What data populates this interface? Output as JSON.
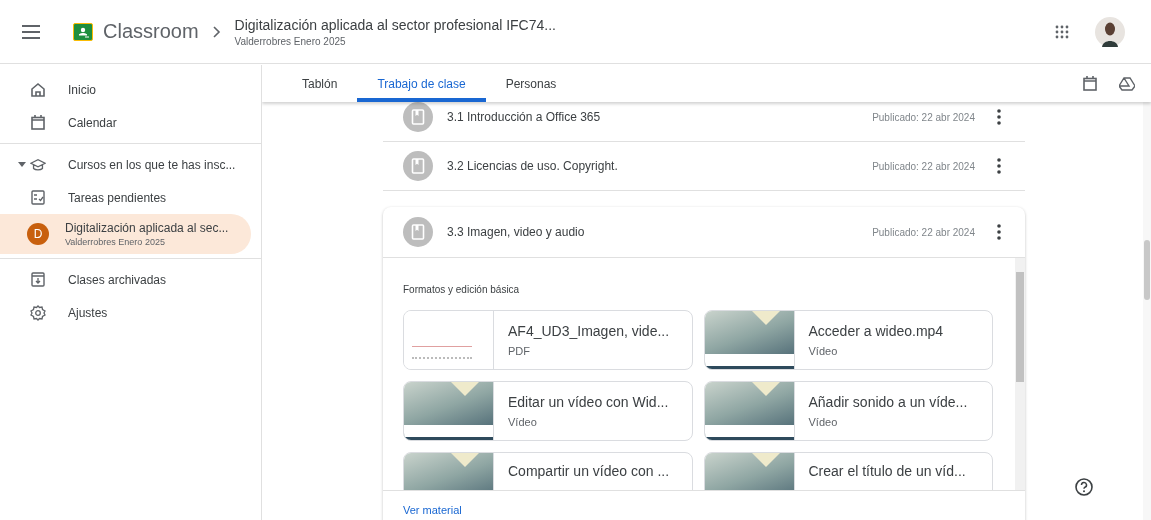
{
  "header": {
    "app_name": "Classroom",
    "course_title": "Digitalización aplicada al sector profesional IFC74...",
    "course_subtitle": "Valderrobres Enero 2025"
  },
  "sidebar": {
    "groups": [
      {
        "items": [
          {
            "kind": "nav",
            "label": "Inicio",
            "selected": false
          },
          {
            "kind": "nav",
            "label": "Calendar",
            "selected": false
          }
        ]
      },
      {
        "items": [
          {
            "kind": "section",
            "label": "Cursos en los que te has insc...",
            "expanded": true,
            "selected": false
          },
          {
            "kind": "nav",
            "label": "Tareas pendientes",
            "selected": false
          },
          {
            "kind": "course",
            "label": "Digitalización aplicada al sec...",
            "subtitle": "Valderrobres Enero 2025",
            "avatar_letter": "D",
            "selected": true
          }
        ]
      },
      {
        "items": [
          {
            "kind": "nav",
            "label": "Clases archivadas",
            "selected": false
          },
          {
            "kind": "nav",
            "label": "Ajustes",
            "selected": false
          }
        ]
      }
    ]
  },
  "tabs": [
    {
      "label": "Tablón",
      "selected": false
    },
    {
      "label": "Trabajo de clase",
      "selected": true
    },
    {
      "label": "Personas",
      "selected": false
    }
  ],
  "topics": [
    {
      "title": "3.1 Introducción a Office 365",
      "published": "Publicado: 22 abr 2024",
      "expanded": false
    },
    {
      "title": "3.2 Licencias de uso. Copyright.",
      "published": "Publicado: 22 abr 2024",
      "expanded": false
    },
    {
      "title": "3.3 Imagen, video y audio",
      "published": "Publicado: 22 abr 2024",
      "expanded": true,
      "section_label": "Formatos y edición básica",
      "link": "Ver material",
      "materials": [
        {
          "kind": "document",
          "title": "AF4_UD3_Imagen, vide...",
          "type": "PDF"
        },
        {
          "kind": "video",
          "title": "Acceder a wideo.mp4",
          "type": "Vídeo"
        },
        {
          "kind": "video",
          "title": "Editar un vídeo con Wid...",
          "type": "Vídeo"
        },
        {
          "kind": "video",
          "title": "Añadir sonido a un víde...",
          "type": "Vídeo"
        },
        {
          "kind": "video",
          "title": "Compartir un vídeo con ..."
        },
        {
          "kind": "video",
          "title": "Crear el título de un víd..."
        }
      ]
    }
  ]
}
